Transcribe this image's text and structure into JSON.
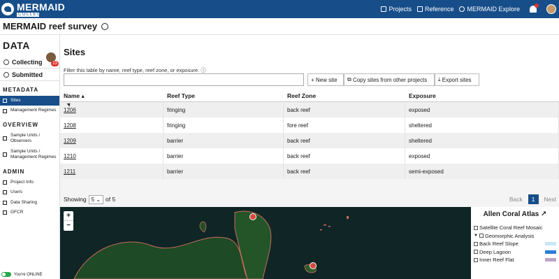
{
  "app": {
    "logo_main": "MERMAID",
    "logo_sub": "COLLECT",
    "nav": [
      "Projects",
      "Reference",
      "MERMAID Explore"
    ]
  },
  "project": {
    "title": "MERMAID reef survey"
  },
  "sidebar": {
    "data_label": "DATA",
    "badge": "23",
    "tabs": [
      "Collecting",
      "Submitted"
    ],
    "sections": {
      "metadata": {
        "label": "METADATA",
        "items": [
          "Sites",
          "Management Regimes"
        ]
      },
      "overview": {
        "label": "OVERVIEW",
        "items": [
          "Sample Units / Observers",
          "Sample Units / Management Regimes"
        ]
      },
      "admin": {
        "label": "ADMIN",
        "items": [
          "Project Info",
          "Users",
          "Data Sharing",
          "GFCR"
        ]
      }
    },
    "status": "You're ONLINE"
  },
  "page": {
    "title": "Sites",
    "filter_label": "Filter this table by name, reef type, reef zone, or exposure.",
    "buttons": {
      "new_site": "New site",
      "copy_sites": "Copy sites from other projects",
      "export": "Export sites"
    }
  },
  "table": {
    "headers": [
      "Name ▴",
      "Reef Type",
      "Reef Zone",
      "Exposure"
    ],
    "rows": [
      [
        "1206",
        "fringing",
        "back reef",
        "exposed"
      ],
      [
        "1208",
        "fringing",
        "fore reef",
        "sheltered"
      ],
      [
        "1209",
        "barrier",
        "back reef",
        "sheltered"
      ],
      [
        "1210",
        "barrier",
        "back reef",
        "exposed"
      ],
      [
        "1211",
        "barrier",
        "back reef",
        "semi-exposed"
      ]
    ]
  },
  "pager": {
    "showing": "Showing",
    "page_size": "5",
    "of_total": "of 5",
    "back": "Back",
    "current": "1",
    "next": "Next"
  },
  "map": {
    "zoom_in": "+",
    "zoom_out": "−"
  },
  "atlas": {
    "title": "Allen Coral Atlas",
    "items": [
      {
        "label": "Satellite Coral Reef Mosaic",
        "color": ""
      },
      {
        "label": "Geomorphic Analysis",
        "color": ""
      },
      {
        "label": "Back Reef Slope",
        "color": "#c8e6f5"
      },
      {
        "label": "Deep Lagoon",
        "color": "#2b7fd6"
      },
      {
        "label": "Inner Reef Flat",
        "color": "#b9a7c4"
      }
    ]
  },
  "colors": {
    "brand": "#174e8a",
    "alert": "#e0332e",
    "online": "#2aa84a"
  }
}
